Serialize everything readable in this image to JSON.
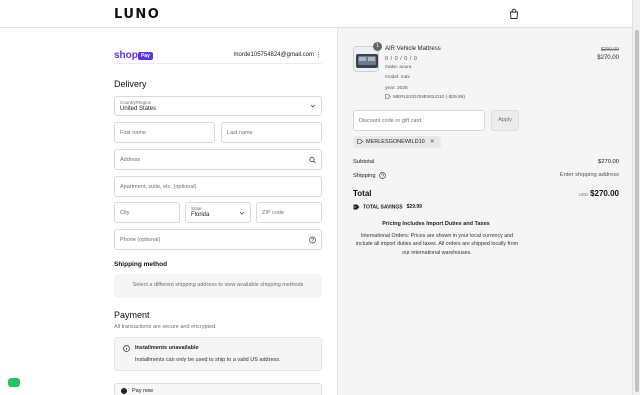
{
  "brand": {
    "logo_text": "LUNO"
  },
  "header": {
    "cart_icon": "shopping-bag-icon"
  },
  "shop_pay": {
    "shop_text": "shop",
    "pay_text": "Pay",
    "email": "morde105754824@gmail.com"
  },
  "delivery": {
    "heading": "Delivery",
    "country_label": "Country/Region",
    "country_value": "United States",
    "first_name_placeholder": "First name",
    "last_name_placeholder": "Last name",
    "address_placeholder": "Address",
    "apartment_placeholder": "Apartment, suite, etc. (optional)",
    "city_placeholder": "City",
    "state_label": "State",
    "state_value": "Florida",
    "zip_placeholder": "ZIP code",
    "phone_placeholder": "Phone (optional)"
  },
  "shipping_method": {
    "heading": "Shipping method",
    "message": "Select a different shipping address to view available shipping methods"
  },
  "payment": {
    "heading": "Payment",
    "subtitle": "All transactions are secure and encrypted.",
    "warning_title": "Installments unavailable",
    "warning_text": "Installments can only be used to ship to a valid US address.",
    "pay_now_label": "Pay now"
  },
  "order": {
    "item": {
      "quantity": "1",
      "name": "AIR Vehicle Mattress",
      "variant": "0 / 0 / 0 / 0",
      "make": "make: acura",
      "model": "model: mdx",
      "year": "year: 2025",
      "discount_line": "MERLESGONEWILD10 (-$29.99)",
      "original_price": "$299.99",
      "price": "$270.00"
    },
    "discount_placeholder": "Discount code or gift card",
    "apply_label": "Apply",
    "applied_code": "MERLESGONEWILD10",
    "subtotal_label": "Subtotal",
    "subtotal_value": "$270.00",
    "shipping_label": "Shipping",
    "shipping_value": "Enter shipping address",
    "total_label": "Total",
    "currency": "USD",
    "total_value": "$270.00",
    "savings_label": "TOTAL SAVINGS",
    "savings_value": "$29.99",
    "duties_title": "Pricing Includes Import Duties and Taxes",
    "duties_text": "International Orders: Prices are shown in your local currency and include all import duties and taxes. All orders are shipped locally from our international warehouses."
  },
  "colors": {
    "shop_pay_purple": "#5a31f4",
    "chat_green": "#22c55e"
  }
}
